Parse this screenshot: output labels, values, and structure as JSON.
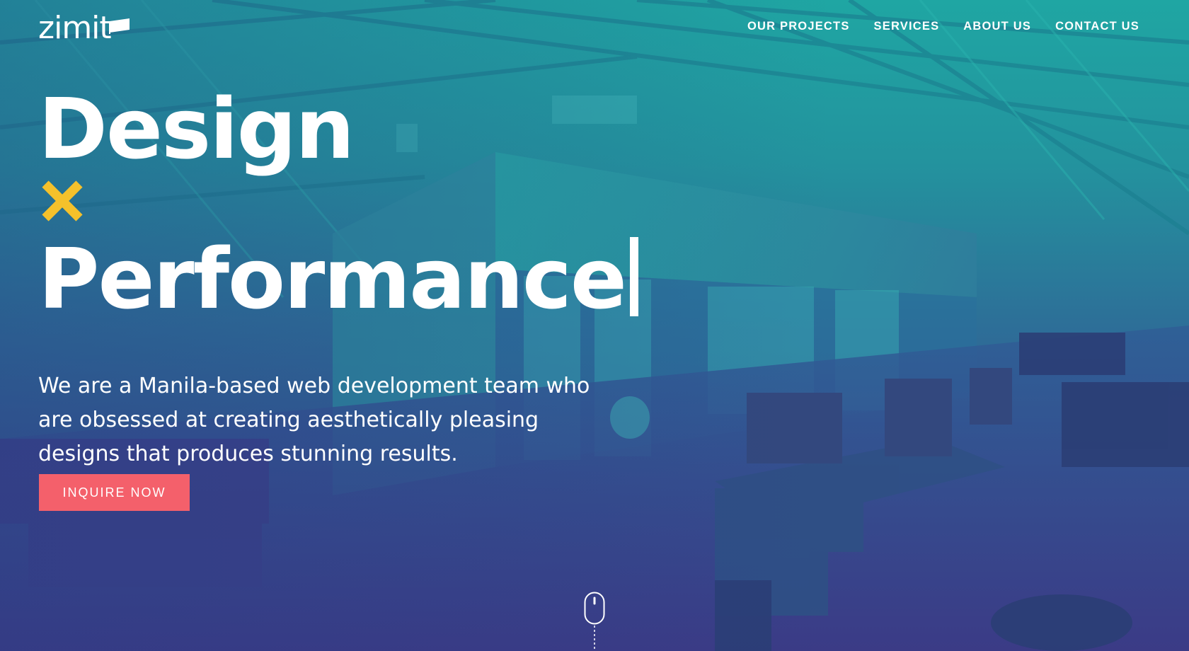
{
  "brand": {
    "logo_text": "zimit"
  },
  "nav": {
    "items": [
      {
        "label": "OUR PROJECTS"
      },
      {
        "label": "SERVICES"
      },
      {
        "label": "ABOUT US"
      },
      {
        "label": "CONTACT US"
      }
    ]
  },
  "hero": {
    "headline_line1": "Design",
    "headline_line2": "Performance",
    "tagline": "We are a Manila-based web development team who are obsessed at creating aesthetically pleasing designs that produces stunning results.",
    "cta_label": "INQUIRE NOW"
  },
  "colors": {
    "accent_x": "#f5c12b",
    "cta_background": "#f4606b",
    "overlay_top": "#1fa6a3",
    "overlay_bottom": "#3a3f88"
  },
  "icons": {
    "brand_flag": "flag-icon",
    "multiply": "times-icon",
    "scroll": "mouse-scroll-icon"
  }
}
